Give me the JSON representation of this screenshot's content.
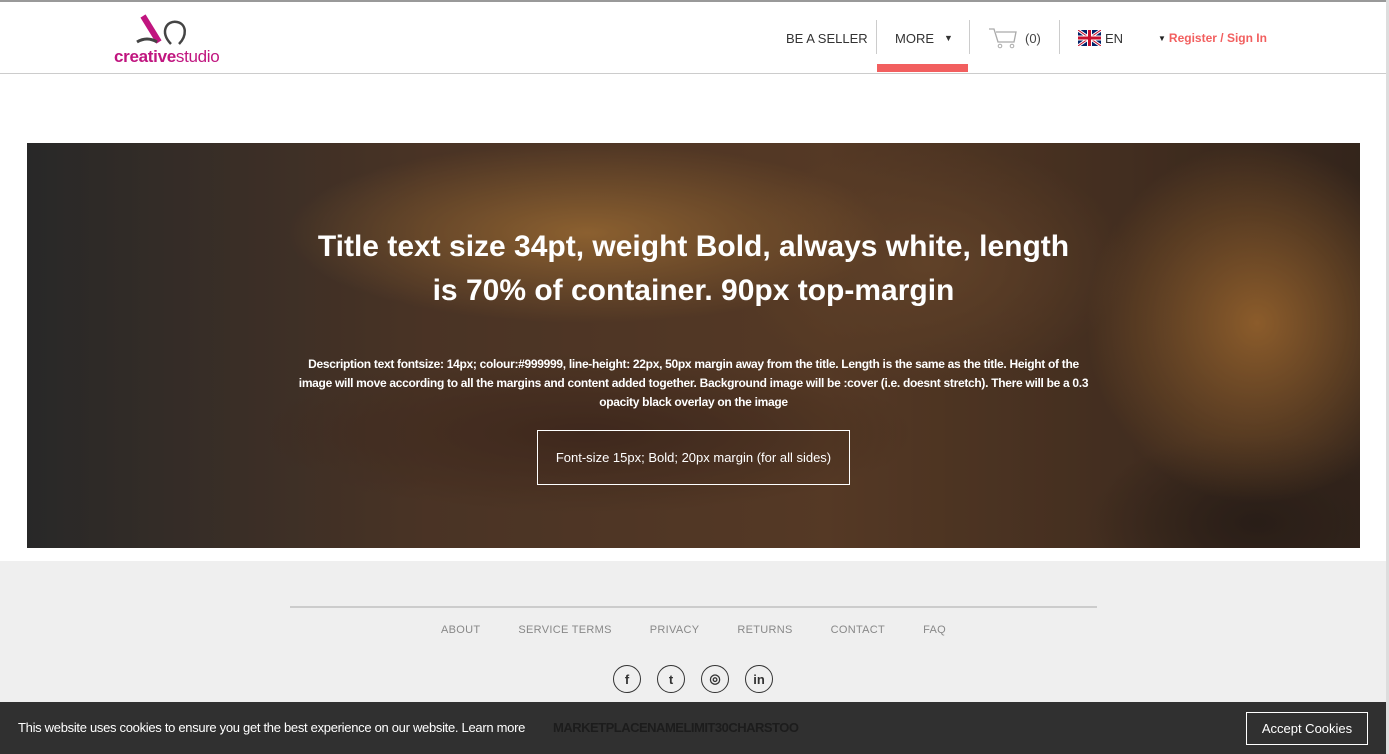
{
  "header": {
    "logo": {
      "bold": "creative",
      "light": "studio"
    },
    "nav": {
      "seller": "BE A SELLER",
      "more": "MORE",
      "cart_count": "(0)",
      "language": "EN",
      "register": "Register / Sign In"
    },
    "accent": "#f25f5f",
    "brand": "#c0157f"
  },
  "hero": {
    "title": "Title text size 34pt, weight Bold, always white, length is 70% of container. 90px top-margin",
    "description": "Description text fontsize: 14px; colour:#999999, line-height: 22px, 50px margin away from the title. Length is the same as the title. Height of the image will move according to all the margins and content added together. Background image will be :cover (i.e. doesnt stretch). There will be a 0.3 opacity black overlay on the image",
    "button": "Font-size 15px; Bold; 20px margin (for all sides)"
  },
  "footer": {
    "links": [
      "ABOUT",
      "SERVICE TERMS",
      "PRIVACY",
      "RETURNS",
      "CONTACT",
      "FAQ"
    ],
    "social": [
      "facebook-icon",
      "twitter-icon",
      "instagram-icon",
      "linkedin-icon"
    ],
    "marketplace_name": "MARKETPLACENAMELIMIT30CHARSTOO"
  },
  "cookie": {
    "text": "This website uses cookies to ensure you get the best experience on our website.",
    "learn_more": "Learn more",
    "accept": "Accept Cookies"
  }
}
